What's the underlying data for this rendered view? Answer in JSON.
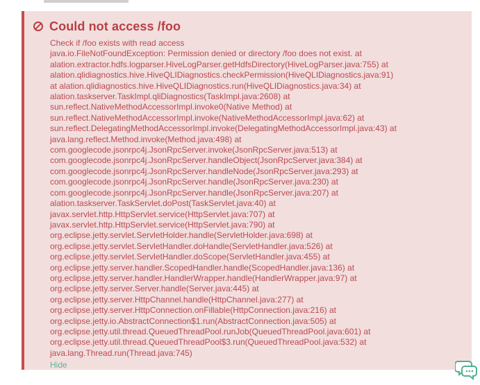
{
  "error": {
    "title": "Could not access /foo",
    "subtitle": "Check if /foo exists with read access",
    "stack_lines": [
      "java.io.FileNotFoundException: Permission denied or directory /foo does not exist. at",
      "alation.extractor.hdfs.logparser.HiveLogParser.getHdfsDirectory(HiveLogParser.java:755) at",
      "alation.qlidiagnostics.hive.HiveQLIDiagnostics.checkPermission(HiveQLIDiagnostics.java:91)",
      "at alation.qlidiagnostics.hive.HiveQLIDiagnostics.run(HiveQLIDiagnostics.java:34) at",
      "alation.taskserver.TaskImpl.qliDiagnostics(TaskImpl.java:2608) at",
      "sun.reflect.NativeMethodAccessorImpl.invoke0(Native Method) at",
      "sun.reflect.NativeMethodAccessorImpl.invoke(NativeMethodAccessorImpl.java:62) at",
      "sun.reflect.DelegatingMethodAccessorImpl.invoke(DelegatingMethodAccessorImpl.java:43) at",
      "java.lang.reflect.Method.invoke(Method.java:498) at",
      "com.googlecode.jsonrpc4j.JsonRpcServer.invoke(JsonRpcServer.java:513) at",
      "com.googlecode.jsonrpc4j.JsonRpcServer.handleObject(JsonRpcServer.java:384) at",
      "com.googlecode.jsonrpc4j.JsonRpcServer.handleNode(JsonRpcServer.java:293) at",
      "com.googlecode.jsonrpc4j.JsonRpcServer.handle(JsonRpcServer.java:230) at",
      "com.googlecode.jsonrpc4j.JsonRpcServer.handle(JsonRpcServer.java:207) at",
      "alation.taskserver.TaskServlet.doPost(TaskServlet.java:40) at",
      "javax.servlet.http.HttpServlet.service(HttpServlet.java:707) at",
      "javax.servlet.http.HttpServlet.service(HttpServlet.java:790) at",
      "org.eclipse.jetty.servlet.ServletHolder.handle(ServletHolder.java:698) at",
      "org.eclipse.jetty.servlet.ServletHandler.doHandle(ServletHandler.java:526) at",
      "org.eclipse.jetty.servlet.ServletHandler.doScope(ServletHandler.java:455) at",
      "org.eclipse.jetty.server.handler.ScopedHandler.handle(ScopedHandler.java:136) at",
      "org.eclipse.jetty.server.handler.HandlerWrapper.handle(HandlerWrapper.java:97) at",
      "org.eclipse.jetty.server.Server.handle(Server.java:445) at",
      "org.eclipse.jetty.server.HttpChannel.handle(HttpChannel.java:277) at",
      "org.eclipse.jetty.server.HttpConnection.onFillable(HttpConnection.java:216) at",
      "org.eclipse.jetty.io.AbstractConnection$1.run(AbstractConnection.java:505) at",
      "org.eclipse.jetty.util.thread.QueuedThreadPool.runJob(QueuedThreadPool.java:601) at",
      "org.eclipse.jetty.util.thread.QueuedThreadPool$3.run(QueuedThreadPool.java:532) at",
      "java.lang.Thread.run(Thread.java:745)"
    ],
    "hide_label": "Hide",
    "icon": "ban-icon"
  },
  "chat": {
    "icon": "chat-bubbles-icon"
  },
  "colors": {
    "error_text": "#b84b50",
    "error_bg": "#f3dede",
    "error_border": "#c74d4f",
    "link": "#5ab59a",
    "chat_icon": "#4fb08f"
  }
}
